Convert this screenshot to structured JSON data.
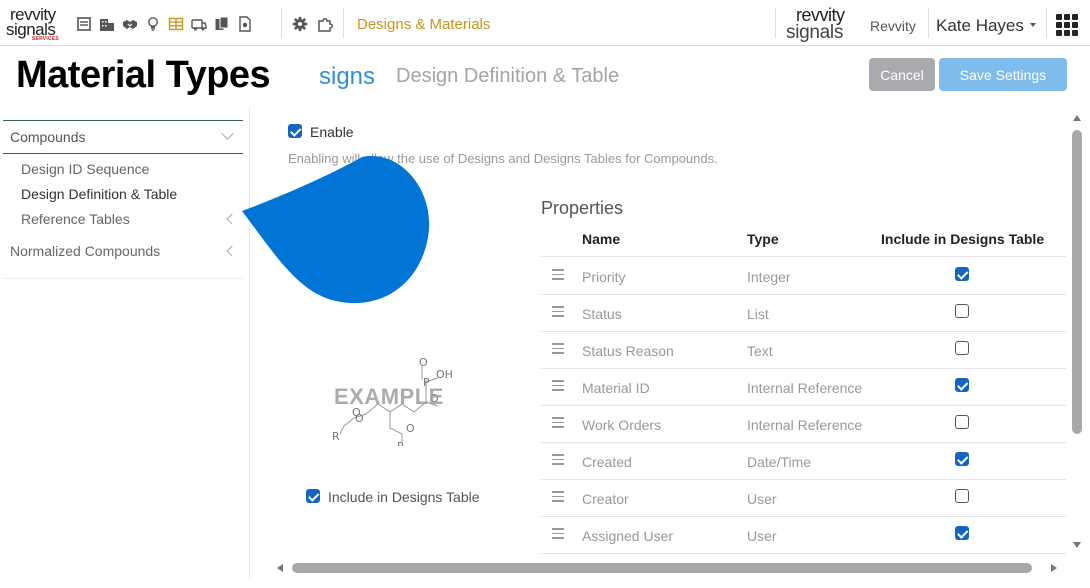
{
  "topbar": {
    "logo_line1": "revvity",
    "logo_line2": "signals",
    "logo_line3": "SERVICES",
    "breadcrumb": "Designs & Materials",
    "right_logo_line1": "revvity",
    "right_logo_line2": "signals",
    "tenant": "Revvity",
    "user": "Kate Hayes",
    "icons": [
      "notebook-icon",
      "buildings-icon",
      "handshake-icon",
      "lightbulb-icon",
      "table-icon",
      "truck-icon",
      "copy-icon",
      "document-icon",
      "gear-icon",
      "puzzle-icon",
      "apps-grid-icon"
    ]
  },
  "header": {
    "overlay_title": "Material Types",
    "title_partial": "signs",
    "subtitle": "Design Definition & Table",
    "cancel_label": "Cancel",
    "save_label": "Save Settings"
  },
  "sidebar": {
    "section": "Compounds",
    "items": [
      "Design ID Sequence",
      "Design Definition & Table",
      "Reference Tables"
    ],
    "selected_index": 1,
    "other_section": "Normalized Compounds"
  },
  "main": {
    "enable_label": "Enable",
    "enable_checked": true,
    "enable_description": "Enabling will allow the use of Designs and Designs Tables for Compounds.",
    "structure_watermark": "EXAMPLE",
    "structure_atoms": [
      "O",
      "OH",
      "P",
      "O",
      "O",
      "O",
      "O",
      "R",
      "R"
    ],
    "include_label": "Include in Designs Table",
    "include_checked": true,
    "properties": {
      "title": "Properties",
      "columns": [
        "Name",
        "Type",
        "Include in Designs Table"
      ],
      "rows": [
        {
          "name": "Priority",
          "type": "Integer",
          "include": true
        },
        {
          "name": "Status",
          "type": "List",
          "include": false
        },
        {
          "name": "Status Reason",
          "type": "Text",
          "include": false
        },
        {
          "name": "Material ID",
          "type": "Internal Reference",
          "include": true
        },
        {
          "name": "Work Orders",
          "type": "Internal Reference",
          "include": false
        },
        {
          "name": "Created",
          "type": "Date/Time",
          "include": true
        },
        {
          "name": "Creator",
          "type": "User",
          "include": false
        },
        {
          "name": "Assigned User",
          "type": "User",
          "include": true
        }
      ]
    }
  },
  "colors": {
    "accent": "#c8961e",
    "checkbox": "#1565c0",
    "save_button": "#7fbcec",
    "cancel_button": "#a8aaad",
    "blob": "#0075d6",
    "section_border": "#2e6a53"
  }
}
